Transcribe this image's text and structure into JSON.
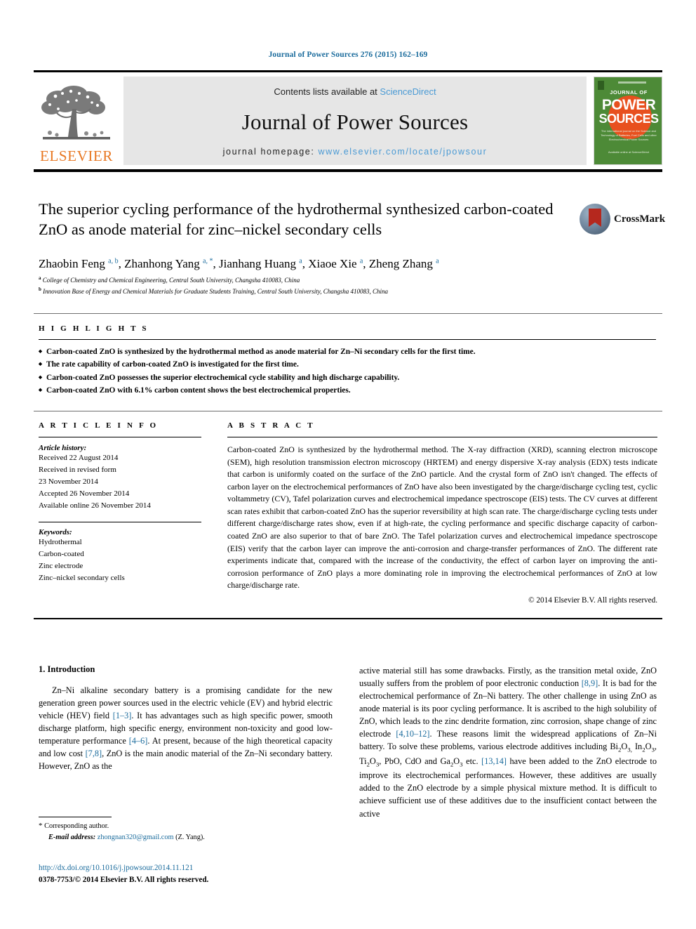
{
  "running_head": "Journal of Power Sources 276 (2015) 162–169",
  "masthead": {
    "publisher_name": "ELSEVIER",
    "contents_prefix": "Contents lists available at ",
    "contents_link": "ScienceDirect",
    "journal_name": "Journal of Power Sources",
    "homepage_prefix": "journal homepage: ",
    "homepage_url": "www.elsevier.com/locate/jpowsour",
    "cover": {
      "journal_of": "JOURNAL OF",
      "power": "POWER",
      "sources": "SOURCES",
      "subtitle": "The international journal on the Science and Technology of Batteries, Fuel Cells and other Electrochemical Power Sources",
      "footer": "Available online at\nScienceDirect"
    }
  },
  "article": {
    "title": "The superior cycling performance of the hydrothermal synthesized carbon-coated ZnO as anode material for zinc–nickel secondary cells",
    "crossmark_label": "CrossMark",
    "authors_html": "Zhaobin Feng <sup>a, b</sup>, Zhanhong Yang <sup>a, *</sup>, Jianhang Huang <sup>a</sup>, Xiaoe Xie <sup>a</sup>, Zheng Zhang <sup>a</sup>",
    "affiliation_a": "College of Chemistry and Chemical Engineering, Central South University, Changsha 410083, China",
    "affiliation_b": "Innovation Base of Energy and Chemical Materials for Graduate Students Training, Central South University, Changsha 410083, China"
  },
  "highlights": {
    "label": "H I G H L I G H T S",
    "items": [
      "Carbon-coated ZnO is synthesized by the hydrothermal method as anode material for Zn–Ni secondary cells for the first time.",
      "The rate capability of carbon-coated ZnO is investigated for the first time.",
      "Carbon-coated ZnO possesses the superior electrochemical cycle stability and high discharge capability.",
      "Carbon-coated ZnO with 6.1% carbon content shows the best electrochemical properties."
    ]
  },
  "article_info": {
    "label": "A R T I C L E    I N F O",
    "history_title": "Article history:",
    "history": [
      "Received 22 August 2014",
      "Received in revised form",
      "23 November 2014",
      "Accepted 26 November 2014",
      "Available online 26 November 2014"
    ],
    "keywords_title": "Keywords:",
    "keywords": [
      "Hydrothermal",
      "Carbon-coated",
      "Zinc electrode",
      "Zinc–nickel secondary cells"
    ]
  },
  "abstract": {
    "label": "A B S T R A C T",
    "text": "Carbon-coated ZnO is synthesized by the hydrothermal method. The X-ray diffraction (XRD), scanning electron microscope (SEM), high resolution transmission electron microscopy (HRTEM) and energy dispersive X-ray analysis (EDX) tests indicate that carbon is uniformly coated on the surface of the ZnO particle. And the crystal form of ZnO isn't changed. The effects of carbon layer on the electrochemical performances of ZnO have also been investigated by the charge/discharge cycling test, cyclic voltammetry (CV), Tafel polarization curves and electrochemical impedance spectroscope (EIS) tests. The CV curves at different scan rates exhibit that carbon-coated ZnO has the superior reversibility at high scan rate. The charge/discharge cycling tests under different charge/discharge rates show, even if at high-rate, the cycling performance and specific discharge capacity of carbon-coated ZnO are also superior to that of bare ZnO. The Tafel polarization curves and electrochemical impedance spectroscope (EIS) verify that the carbon layer can improve the anti-corrosion and charge-transfer performances of ZnO. The different rate experiments indicate that, compared with the increase of the conductivity, the effect of carbon layer on improving the anti-corrosion performance of ZnO plays a more dominating role in improving the electrochemical performances of ZnO at low charge/discharge rate.",
    "copyright": "© 2014 Elsevier B.V. All rights reserved."
  },
  "body": {
    "section_heading": "1.  Introduction",
    "left_paragraph_html": "Zn–Ni alkaline secondary battery is a promising candidate for the new generation green power sources used in the electric vehicle (EV) and hybrid electric vehicle (HEV) field <span class=\"ref\">[1–3]</span>. It has advantages such as high specific power, smooth discharge platform, high specific energy, environment non-toxicity and good low-temperature performance <span class=\"ref\">[4–6]</span>. At present, because of the high theoretical capacity and low cost <span class=\"ref\">[7,8]</span>, ZnO is the main anodic material of the Zn–Ni secondary battery. However, ZnO as the",
    "right_paragraph_html": "active material still has some drawbacks. Firstly, as the transition metal oxide, ZnO usually suffers from the problem of poor electronic conduction <span class=\"ref\">[8,9]</span>. It is bad for the electrochemical performance of Zn–Ni battery. The other challenge in using ZnO as anode material is its poor cycling performance. It is ascribed to the high solubility of ZnO, which leads to the zinc dendrite formation, zinc corrosion, shape change of zinc electrode <span class=\"ref\">[4,10–12]</span>. These reasons limit the widespread applications of Zn–Ni battery. To solve these problems, various electrode additives including Bi<sub>2</sub>O<sub>3,</sub> In<sub>2</sub>O<sub>3</sub>, Ti<sub>2</sub>O<sub>3</sub>, PbO, CdO and Ga<sub>2</sub>O<sub>3</sub> etc. <span class=\"ref\">[13,14]</span> have been added to the ZnO electrode to improve its electrochemical performances. However, these additives are usually added to the ZnO electrode by a simple physical mixture method. It is difficult to achieve sufficient use of these additives due to the insufficient contact between the active"
  },
  "footnote": {
    "corresponding": "Corresponding author.",
    "email_label": "E-mail address:",
    "email": "zhongnan320@gmail.com",
    "email_suffix": "(Z. Yang)."
  },
  "footer": {
    "doi": "http://dx.doi.org/10.1016/j.jpowsour.2014.11.121",
    "issn": "0378-7753/© 2014 Elsevier B.V. All rights reserved."
  },
  "colors": {
    "link_blue": "#1a6b9c",
    "sciencedirect_blue": "#4a9ad4",
    "elsevier_orange": "#e87722",
    "cover_green": "#4d8a37",
    "cover_orange": "#e8501e"
  }
}
